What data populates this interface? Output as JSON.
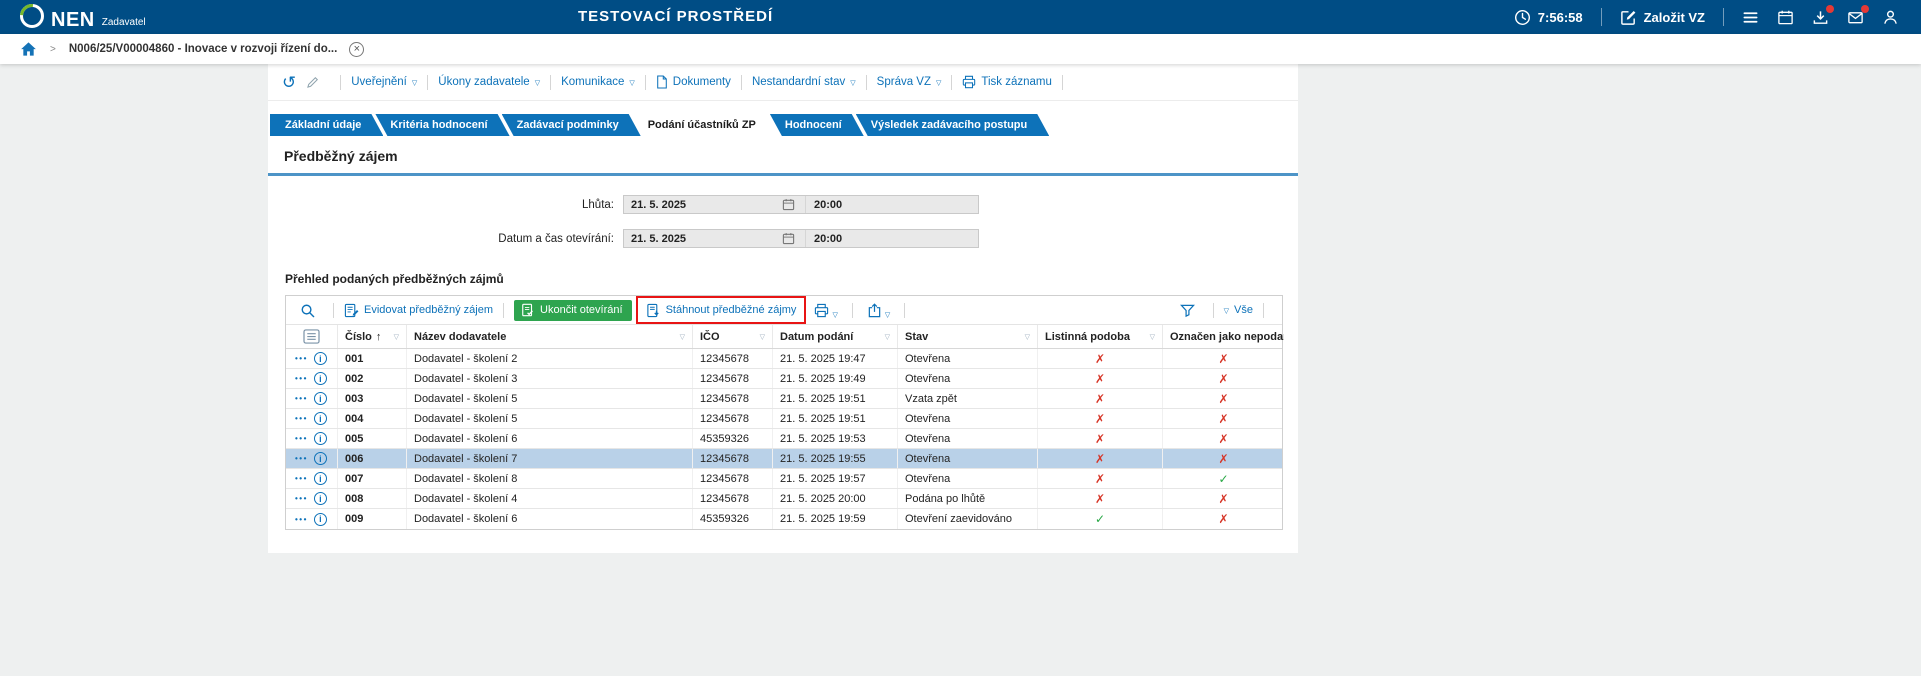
{
  "colors": {
    "topbar_bg": "#004d85",
    "accent_blue": "#0d72b9",
    "green_button_bg": "#2ea44f",
    "annotation_red": "#e81414",
    "selected_row_bg": "#b9d1e8",
    "cross_red": "#d63426",
    "check_green": "#28a745"
  },
  "header": {
    "app_name": "NEN",
    "app_role": "Zadavatel",
    "env_title": "TESTOVACÍ PROSTŘEDÍ",
    "time": "7:56:58",
    "create_button": "Založit VZ",
    "notifications": {
      "downloads": true,
      "messages": true
    }
  },
  "breadcrumb": {
    "current": "N006/25/V00004860 - Inovace v rozvoji řízení do..."
  },
  "menu": {
    "items": [
      {
        "label": "Uveřejnění",
        "dropdown": true
      },
      {
        "label": "Úkony zadavatele",
        "dropdown": true
      },
      {
        "label": "Komunikace",
        "dropdown": true
      },
      {
        "label": "Dokumenty",
        "dropdown": false,
        "icon": "document-icon"
      },
      {
        "label": "Nestandardní stav",
        "dropdown": true
      },
      {
        "label": "Správa VZ",
        "dropdown": true
      },
      {
        "label": "Tisk záznamu",
        "dropdown": false,
        "icon": "printer-icon"
      }
    ]
  },
  "tabs": [
    {
      "label": "Základní údaje",
      "active": false
    },
    {
      "label": "Kritéria hodnocení",
      "active": false
    },
    {
      "label": "Zadávací podmínky",
      "active": false
    },
    {
      "label": "Podání účastníků ZP",
      "active": true
    },
    {
      "label": "Hodnocení",
      "active": false
    },
    {
      "label": "Výsledek zadávacího postupu",
      "active": false
    }
  ],
  "section": {
    "title": "Předběžný zájem"
  },
  "form": {
    "fields": [
      {
        "label": "Lhůta:",
        "date": "21. 5. 2025",
        "time": "20:00"
      },
      {
        "label": "Datum a čas otevírání:",
        "date": "21. 5. 2025",
        "time": "20:00"
      }
    ]
  },
  "list": {
    "title": "Přehled podaných předběžných zájmů",
    "toolbar": {
      "evidovat_label": "Evidovat předběžný zájem",
      "ukoncit_label": "Ukončit otevírání",
      "stahnout_label": "Stáhnout předběžné zájmy",
      "vse_label": "Vše"
    },
    "columns": [
      {
        "label": "Číslo",
        "sorted": "asc"
      },
      {
        "label": "Název dodavatele"
      },
      {
        "label": "IČO"
      },
      {
        "label": "Datum podání"
      },
      {
        "label": "Stav"
      },
      {
        "label": "Listinná podoba"
      },
      {
        "label": "Označen jako nepodaný"
      }
    ],
    "rows": [
      {
        "cislo": "001",
        "nazev": "Dodavatel - školení 2",
        "ico": "12345678",
        "datum_podani": "21. 5. 2025 19:47",
        "stav": "Otevřena",
        "listinna_podoba": false,
        "oznacen_nepodany": false,
        "selected": false
      },
      {
        "cislo": "002",
        "nazev": "Dodavatel - školení 3",
        "ico": "12345678",
        "datum_podani": "21. 5. 2025 19:49",
        "stav": "Otevřena",
        "listinna_podoba": false,
        "oznacen_nepodany": false,
        "selected": false
      },
      {
        "cislo": "003",
        "nazev": "Dodavatel - školení 5",
        "ico": "12345678",
        "datum_podani": "21. 5. 2025 19:51",
        "stav": "Vzata zpět",
        "listinna_podoba": false,
        "oznacen_nepodany": false,
        "selected": false
      },
      {
        "cislo": "004",
        "nazev": "Dodavatel - školení 5",
        "ico": "12345678",
        "datum_podani": "21. 5. 2025 19:51",
        "stav": "Otevřena",
        "listinna_podoba": false,
        "oznacen_nepodany": false,
        "selected": false
      },
      {
        "cislo": "005",
        "nazev": "Dodavatel - školení 6",
        "ico": "45359326",
        "datum_podani": "21. 5. 2025 19:53",
        "stav": "Otevřena",
        "listinna_podoba": false,
        "oznacen_nepodany": false,
        "selected": false
      },
      {
        "cislo": "006",
        "nazev": "Dodavatel - školení 7",
        "ico": "12345678",
        "datum_podani": "21. 5. 2025 19:55",
        "stav": "Otevřena",
        "listinna_podoba": false,
        "oznacen_nepodany": false,
        "selected": true
      },
      {
        "cislo": "007",
        "nazev": "Dodavatel - školení 8",
        "ico": "12345678",
        "datum_podani": "21. 5. 2025 19:57",
        "stav": "Otevřena",
        "listinna_podoba": false,
        "oznacen_nepodany": true,
        "selected": false
      },
      {
        "cislo": "008",
        "nazev": "Dodavatel - školení 4",
        "ico": "12345678",
        "datum_podani": "21. 5. 2025 20:00",
        "stav": "Podána po lhůtě",
        "listinna_podoba": false,
        "oznacen_nepodany": false,
        "selected": false
      },
      {
        "cislo": "009",
        "nazev": "Dodavatel - školení 6",
        "ico": "45359326",
        "datum_podani": "21. 5. 2025 19:59",
        "stav": "Otevření zaevidováno",
        "listinna_podoba": true,
        "oznacen_nepodany": false,
        "selected": false
      }
    ]
  }
}
